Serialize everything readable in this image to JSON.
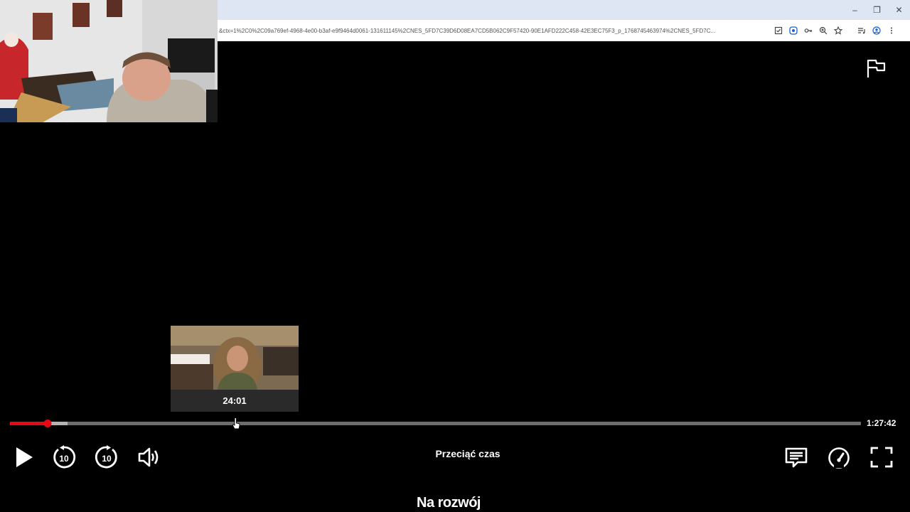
{
  "browser": {
    "url": "&ctx=1%2C0%2C09a769ef-4968-4e00-b3af-e9f9464d0061-131611145%2CNES_5FD7C39D6D08EA7CD5B062C9F57420-90E1AFD222C458-42E3EC75F3_p_1768745463974%2CNES_5FD7C...",
    "window_controls": [
      "–",
      "❐",
      "✕"
    ]
  },
  "player": {
    "preview_time": "24:01",
    "duration": "1:27:42",
    "status_text": "Przeciąć czas",
    "title": "Na rozwój",
    "progress": {
      "played_fraction": 0.044,
      "buffered_fraction": 0.068,
      "hover_fraction": 0.264
    }
  },
  "icons": {
    "flag": "flag-icon",
    "play": "play-icon",
    "rewind": "rewind-10-icon",
    "forward": "forward-10-icon",
    "volume": "volume-icon",
    "subtitles": "subtitles-icon",
    "speed": "playback-speed-icon",
    "fullscreen": "fullscreen-icon"
  },
  "colors": {
    "accent": "#e50914",
    "track": "#6d6d6d",
    "buffer": "#b3b3b3",
    "background": "#000000"
  },
  "skip_seconds": "10"
}
